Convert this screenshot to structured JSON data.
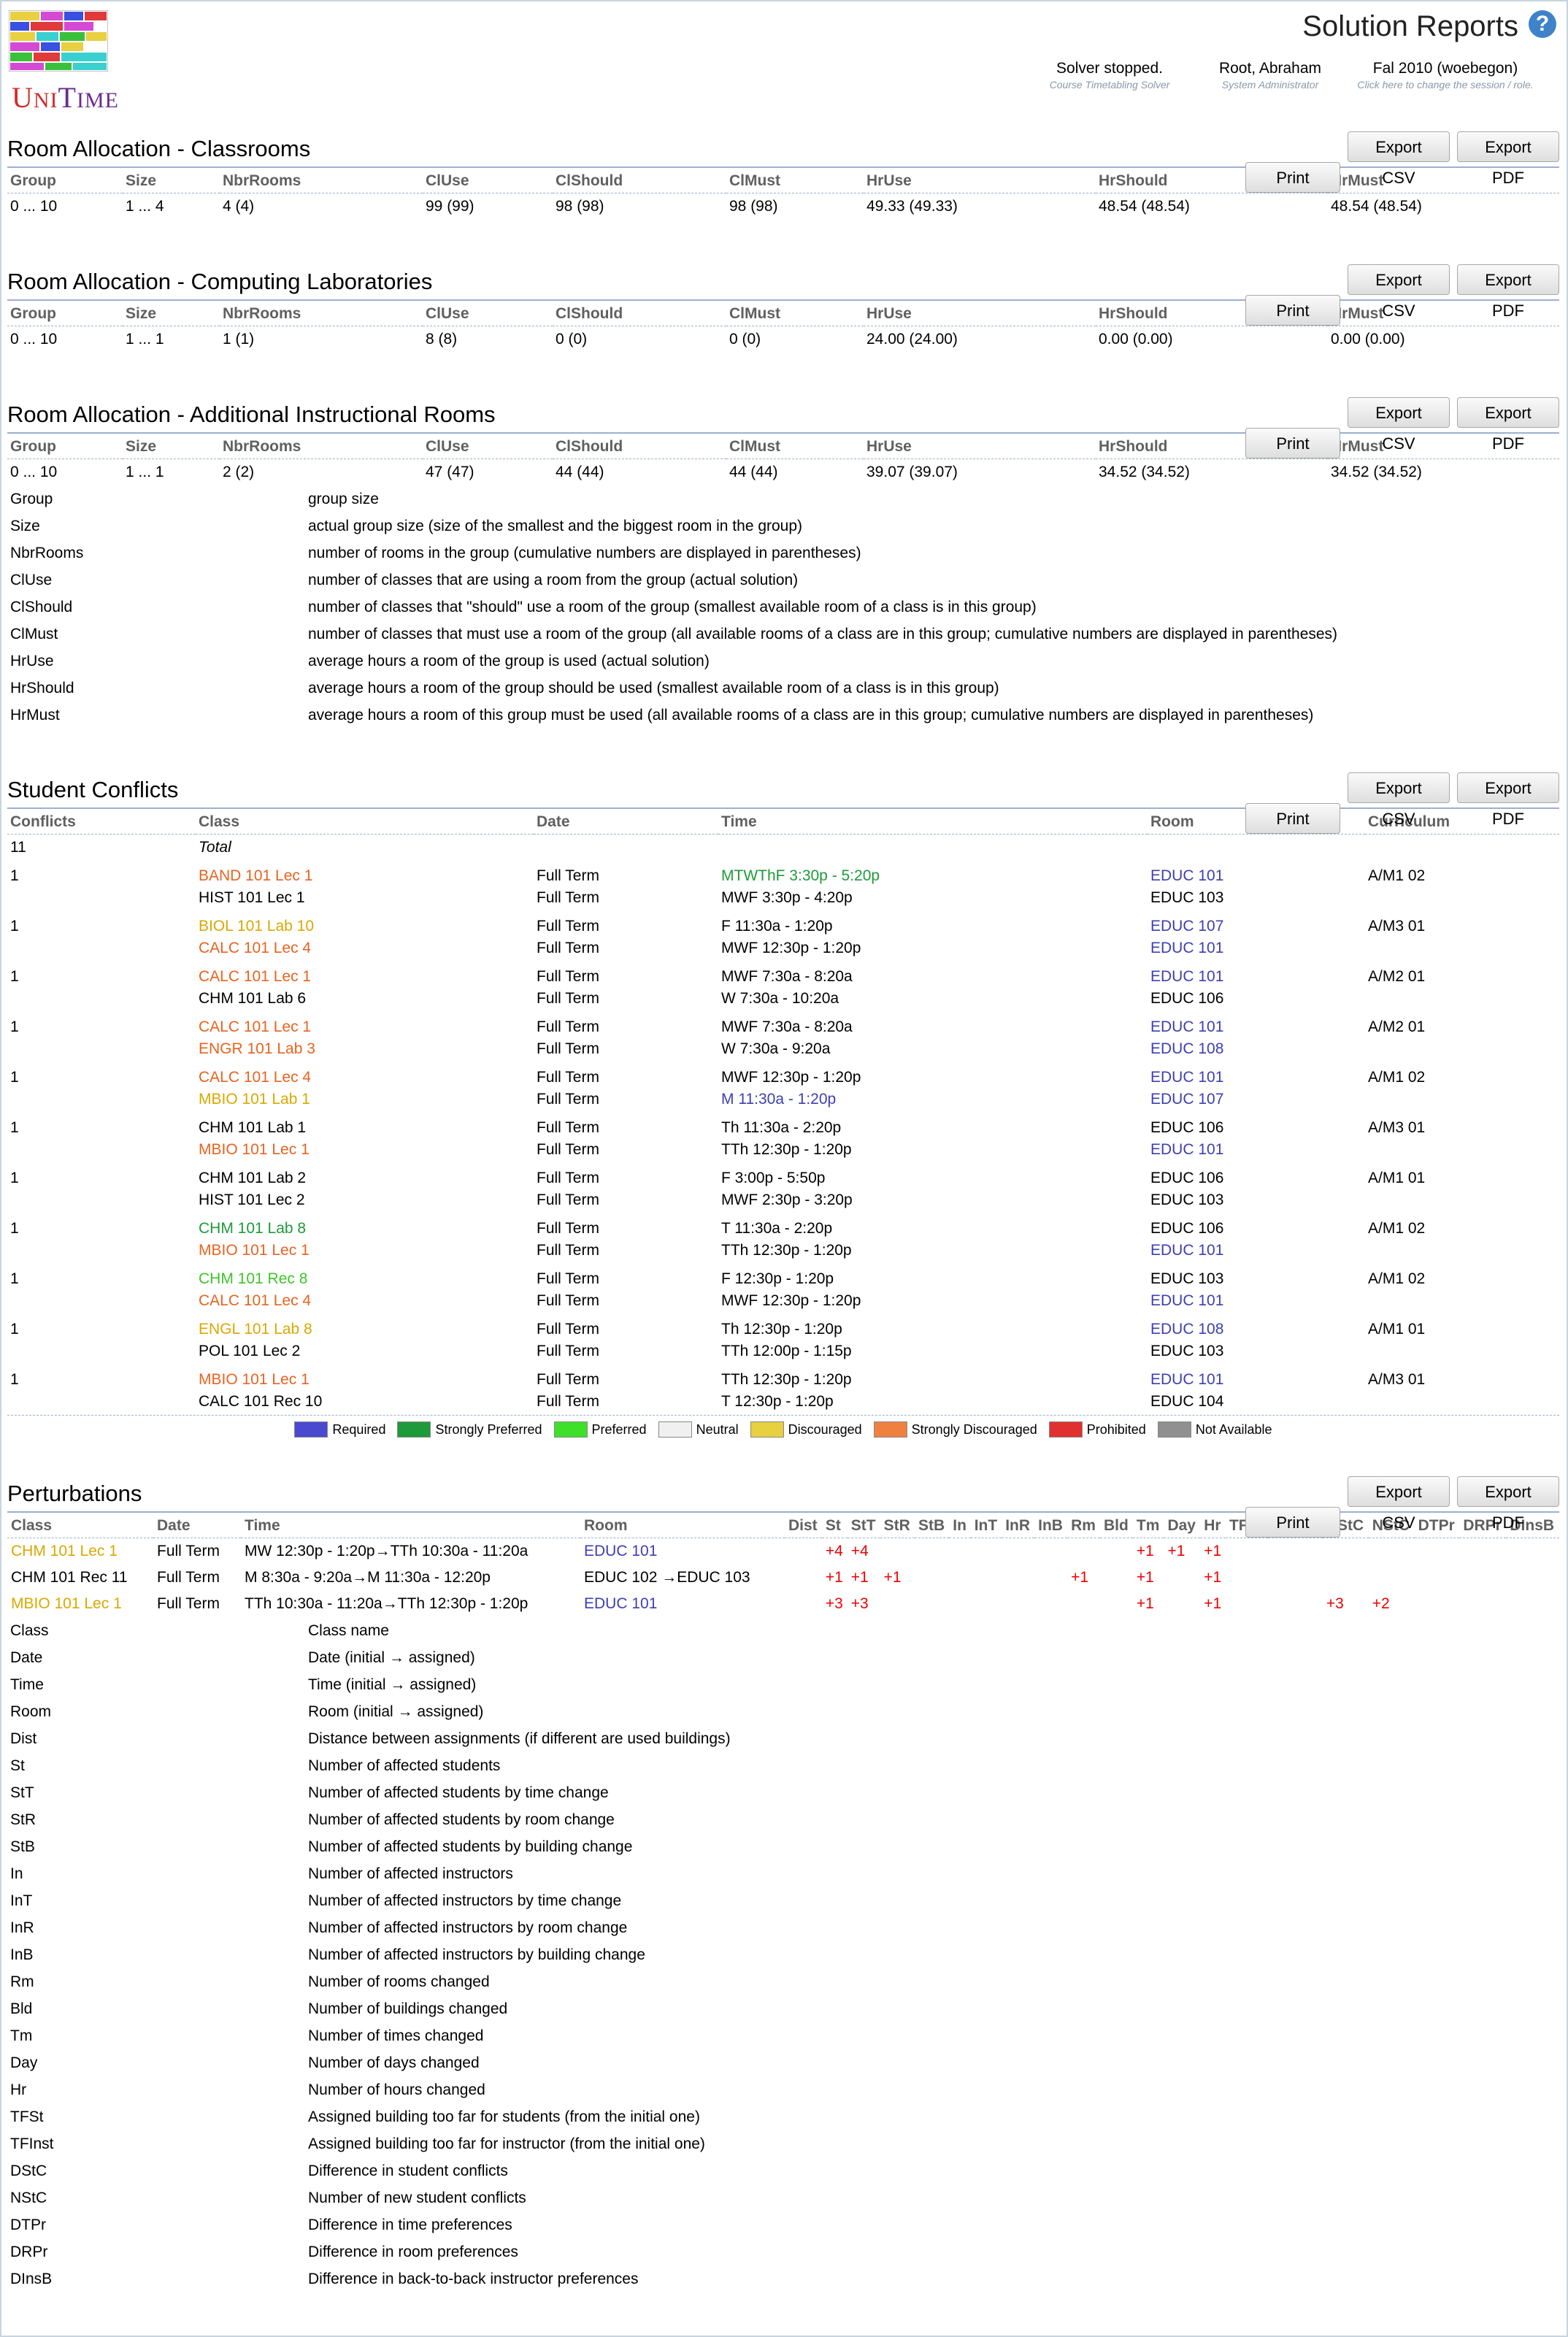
{
  "header": {
    "title": "Solution Reports",
    "help_icon": "?",
    "status": {
      "main": "Solver stopped.",
      "sub": "Course Timetabling Solver"
    },
    "user": {
      "main": "Root, Abraham",
      "sub": "System Administrator"
    },
    "session": {
      "main": "Fal 2010 (woebegon)",
      "sub": "Click here to change the session / role."
    },
    "logo": {
      "u": "U",
      "ni": "NI",
      "t": "T",
      "ime": "IME"
    }
  },
  "buttons": {
    "print": "Print",
    "csv": "Export CSV",
    "pdf": "Export PDF"
  },
  "room_columns": [
    "Group",
    "Size",
    "NbrRooms",
    "ClUse",
    "ClShould",
    "ClMust",
    "HrUse",
    "HrShould",
    "HrMust"
  ],
  "classrooms": {
    "title": "Room Allocation - Classrooms",
    "row": [
      "0 ... 10",
      "1 ... 4",
      "4 (4)",
      "99 (99)",
      "98 (98)",
      "98 (98)",
      "49.33 (49.33)",
      "48.54 (48.54)",
      "48.54 (48.54)"
    ]
  },
  "labs": {
    "title": "Room Allocation - Computing Laboratories",
    "row": [
      "0 ... 10",
      "1 ... 1",
      "1 (1)",
      "8 (8)",
      "0 (0)",
      "0 (0)",
      "24.00 (24.00)",
      "0.00 (0.00)",
      "0.00 (0.00)"
    ]
  },
  "additional": {
    "title": "Room Allocation - Additional Instructional Rooms",
    "row": [
      "0 ... 10",
      "1 ... 1",
      "2 (2)",
      "47 (47)",
      "44 (44)",
      "44 (44)",
      "39.07 (39.07)",
      "34.52 (34.52)",
      "34.52 (34.52)"
    ]
  },
  "room_legend": [
    [
      "Group",
      "group size"
    ],
    [
      "Size",
      "actual group size (size of the smallest and the biggest room in the group)"
    ],
    [
      "NbrRooms",
      "number of rooms in the group (cumulative numbers are displayed in parentheses)"
    ],
    [
      "ClUse",
      "number of classes that are using a room from the group (actual solution)"
    ],
    [
      "ClShould",
      "number of classes that \"should\" use a room of the group (smallest available room of a class is in this group)"
    ],
    [
      "ClMust",
      "number of classes that must use a room of the group (all available rooms of a class are in this group; cumulative numbers are displayed in parentheses)"
    ],
    [
      "HrUse",
      "average hours a room of the group is used (actual solution)"
    ],
    [
      "HrShould",
      "average hours a room of the group should be used (smallest available room of a class is in this group)"
    ],
    [
      "HrMust",
      "average hours a room of this group must be used (all available rooms of a class are in this group; cumulative numbers are displayed in parentheses)"
    ]
  ],
  "conflicts": {
    "title": "Student Conflicts",
    "columns": [
      "Conflicts",
      "Class",
      "Date",
      "Time",
      "Room",
      "Curriculum"
    ],
    "total": {
      "count": "11",
      "label": "Total"
    },
    "rows": [
      {
        "n": "1",
        "cur": "A/M1 02",
        "items": [
          {
            "cls": "BAND 101 Lec 1",
            "cc": "orange",
            "date": "Full Term",
            "time": "MTWThF 3:30p - 5:20p",
            "tc": "green",
            "room": "EDUC 101",
            "rc": "blue"
          },
          {
            "cls": "HIST 101 Lec 1",
            "cc": "",
            "date": "Full Term",
            "time": "MWF 3:30p - 4:20p",
            "tc": "",
            "room": "EDUC 103",
            "rc": ""
          }
        ]
      },
      {
        "n": "1",
        "cur": "A/M3 01",
        "items": [
          {
            "cls": "BIOL 101 Lab 10",
            "cc": "yellow",
            "date": "Full Term",
            "time": "F 11:30a - 1:20p",
            "tc": "",
            "room": "EDUC 107",
            "rc": "blue"
          },
          {
            "cls": "CALC 101 Lec 4",
            "cc": "orange",
            "date": "Full Term",
            "time": "MWF 12:30p - 1:20p",
            "tc": "",
            "room": "EDUC 101",
            "rc": "blue"
          }
        ]
      },
      {
        "n": "1",
        "cur": "A/M2 01",
        "items": [
          {
            "cls": "CALC 101 Lec 1",
            "cc": "orange",
            "date": "Full Term",
            "time": "MWF 7:30a - 8:20a",
            "tc": "",
            "room": "EDUC 101",
            "rc": "blue"
          },
          {
            "cls": "CHM 101 Lab 6",
            "cc": "",
            "date": "Full Term",
            "time": "W 7:30a - 10:20a",
            "tc": "",
            "room": "EDUC 106",
            "rc": ""
          }
        ]
      },
      {
        "n": "1",
        "cur": "A/M2 01",
        "items": [
          {
            "cls": "CALC 101 Lec 1",
            "cc": "orange",
            "date": "Full Term",
            "time": "MWF 7:30a - 8:20a",
            "tc": "",
            "room": "EDUC 101",
            "rc": "blue"
          },
          {
            "cls": "ENGR 101 Lab 3",
            "cc": "orange",
            "date": "Full Term",
            "time": "W 7:30a - 9:20a",
            "tc": "",
            "room": "EDUC 108",
            "rc": "blue"
          }
        ]
      },
      {
        "n": "1",
        "cur": "A/M1 02",
        "items": [
          {
            "cls": "CALC 101 Lec 4",
            "cc": "orange",
            "date": "Full Term",
            "time": "MWF 12:30p - 1:20p",
            "tc": "",
            "room": "EDUC 101",
            "rc": "blue"
          },
          {
            "cls": "MBIO 101 Lab 1",
            "cc": "yellow",
            "date": "Full Term",
            "time": "M 11:30a - 1:20p",
            "tc": "blue",
            "room": "EDUC 107",
            "rc": "blue"
          }
        ]
      },
      {
        "n": "1",
        "cur": "A/M3 01",
        "items": [
          {
            "cls": "CHM 101 Lab 1",
            "cc": "",
            "date": "Full Term",
            "time": "Th 11:30a - 2:20p",
            "tc": "",
            "room": "EDUC 106",
            "rc": ""
          },
          {
            "cls": "MBIO 101 Lec 1",
            "cc": "orange",
            "date": "Full Term",
            "time": "TTh 12:30p - 1:20p",
            "tc": "",
            "room": "EDUC 101",
            "rc": "blue"
          }
        ]
      },
      {
        "n": "1",
        "cur": "A/M1 01",
        "items": [
          {
            "cls": "CHM 101 Lab 2",
            "cc": "",
            "date": "Full Term",
            "time": "F 3:00p - 5:50p",
            "tc": "",
            "room": "EDUC 106",
            "rc": ""
          },
          {
            "cls": "HIST 101 Lec 2",
            "cc": "",
            "date": "Full Term",
            "time": "MWF 2:30p - 3:20p",
            "tc": "",
            "room": "EDUC 103",
            "rc": ""
          }
        ]
      },
      {
        "n": "1",
        "cur": "A/M1 02",
        "items": [
          {
            "cls": "CHM 101 Lab 8",
            "cc": "green",
            "date": "Full Term",
            "time": "T 11:30a - 2:20p",
            "tc": "",
            "room": "EDUC 106",
            "rc": ""
          },
          {
            "cls": "MBIO 101 Lec 1",
            "cc": "orange",
            "date": "Full Term",
            "time": "TTh 12:30p - 1:20p",
            "tc": "",
            "room": "EDUC 101",
            "rc": "blue"
          }
        ]
      },
      {
        "n": "1",
        "cur": "A/M1 02",
        "items": [
          {
            "cls": "CHM 101 Rec 8",
            "cc": "lgreen",
            "date": "Full Term",
            "time": "F 12:30p - 1:20p",
            "tc": "",
            "room": "EDUC 103",
            "rc": ""
          },
          {
            "cls": "CALC 101 Lec 4",
            "cc": "orange",
            "date": "Full Term",
            "time": "MWF 12:30p - 1:20p",
            "tc": "",
            "room": "EDUC 101",
            "rc": "blue"
          }
        ]
      },
      {
        "n": "1",
        "cur": "A/M1 01",
        "items": [
          {
            "cls": "ENGL 101 Lab 8",
            "cc": "yellow",
            "date": "Full Term",
            "time": "Th 12:30p - 1:20p",
            "tc": "",
            "room": "EDUC 108",
            "rc": "blue"
          },
          {
            "cls": "POL 101 Lec 2",
            "cc": "",
            "date": "Full Term",
            "time": "TTh 12:00p - 1:15p",
            "tc": "",
            "room": "EDUC 103",
            "rc": ""
          }
        ]
      },
      {
        "n": "1",
        "cur": "A/M3 01",
        "items": [
          {
            "cls": "MBIO 101 Lec 1",
            "cc": "orange",
            "date": "Full Term",
            "time": "TTh 12:30p - 1:20p",
            "tc": "",
            "room": "EDUC 101",
            "rc": "blue"
          },
          {
            "cls": "CALC 101 Rec 10",
            "cc": "",
            "date": "Full Term",
            "time": "T 12:30p - 1:20p",
            "tc": "",
            "room": "EDUC 104",
            "rc": ""
          }
        ]
      }
    ]
  },
  "pref_legend": [
    {
      "label": "Required",
      "color": "#4a4ad0"
    },
    {
      "label": "Strongly Preferred",
      "color": "#1e9a3a"
    },
    {
      "label": "Preferred",
      "color": "#3fe02a"
    },
    {
      "label": "Neutral",
      "color": "#f0f0f0"
    },
    {
      "label": "Discouraged",
      "color": "#e8d040"
    },
    {
      "label": "Strongly Discouraged",
      "color": "#f08040"
    },
    {
      "label": "Prohibited",
      "color": "#e03030"
    },
    {
      "label": "Not Available",
      "color": "#909090"
    }
  ],
  "perturbations": {
    "title": "Perturbations",
    "columns": [
      "Class",
      "Date",
      "Time",
      "Room",
      "Dist",
      "St",
      "StT",
      "StR",
      "StB",
      "In",
      "InT",
      "InR",
      "InB",
      "Rm",
      "Bld",
      "Tm",
      "Day",
      "Hr",
      "TFSt",
      "TFInst",
      "DStC",
      "NStC",
      "DTPr",
      "DRPr",
      "DInsB"
    ],
    "rows": [
      {
        "cls": "CHM 101 Lec 1",
        "cc": "yellow",
        "date": "Full Term",
        "time": "MW 12:30p - 1:20p→TTh 10:30a - 11:20a",
        "room": "EDUC 101",
        "rc": "blue",
        "vals": [
          "",
          "+4",
          "+4",
          "",
          "",
          "",
          "",
          "",
          "",
          "",
          "",
          "+1",
          "+1",
          "+1",
          "",
          "",
          "",
          "",
          "",
          "",
          ""
        ]
      },
      {
        "cls": "CHM 101 Rec 11",
        "cc": "",
        "date": "Full Term",
        "time": "M 8:30a - 9:20a→M 11:30a - 12:20p",
        "room": "EDUC 102 →EDUC 103",
        "rc": "",
        "vals": [
          "",
          "+1",
          "+1",
          "+1",
          "",
          "",
          "",
          "",
          "",
          "+1",
          "",
          "+1",
          "",
          "+1",
          "",
          "",
          "",
          "",
          "",
          "",
          ""
        ]
      },
      {
        "cls": "MBIO 101 Lec 1",
        "cc": "yellow",
        "date": "Full Term",
        "time": "TTh 10:30a - 11:20a→TTh 12:30p - 1:20p",
        "room": "EDUC 101",
        "rc": "blue",
        "vals": [
          "",
          "+3",
          "+3",
          "",
          "",
          "",
          "",
          "",
          "",
          "",
          "",
          "+1",
          "",
          "+1",
          "",
          "",
          "+3",
          "+2",
          "",
          "",
          ""
        ]
      }
    ]
  },
  "pert_legend": [
    [
      "Class",
      "Class name"
    ],
    [
      "Date",
      "Date (initial → assigned)"
    ],
    [
      "Time",
      "Time (initial → assigned)"
    ],
    [
      "Room",
      "Room (initial → assigned)"
    ],
    [
      "Dist",
      "Distance between assignments (if different are used buildings)"
    ],
    [
      "St",
      "Number of affected students"
    ],
    [
      "StT",
      "Number of affected students by time change"
    ],
    [
      "StR",
      "Number of affected students by room change"
    ],
    [
      "StB",
      "Number of affected students by building change"
    ],
    [
      "In",
      "Number of affected instructors"
    ],
    [
      "InT",
      "Number of affected instructors by time change"
    ],
    [
      "InR",
      "Number of affected instructors by room change"
    ],
    [
      "InB",
      "Number of affected instructors by building change"
    ],
    [
      "Rm",
      "Number of rooms changed"
    ],
    [
      "Bld",
      "Number of buildings changed"
    ],
    [
      "Tm",
      "Number of times changed"
    ],
    [
      "Day",
      "Number of days changed"
    ],
    [
      "Hr",
      "Number of hours changed"
    ],
    [
      "TFSt",
      "Assigned building too far for students (from the initial one)"
    ],
    [
      "TFInst",
      "Assigned building too far for instructor (from the initial one)"
    ],
    [
      "DStC",
      "Difference in student conflicts"
    ],
    [
      "NStC",
      "Number of new student conflicts"
    ],
    [
      "DTPr",
      "Difference in time preferences"
    ],
    [
      "DRPr",
      "Difference in room preferences"
    ],
    [
      "DInsB",
      "Difference in back-to-back instructor preferences"
    ]
  ]
}
